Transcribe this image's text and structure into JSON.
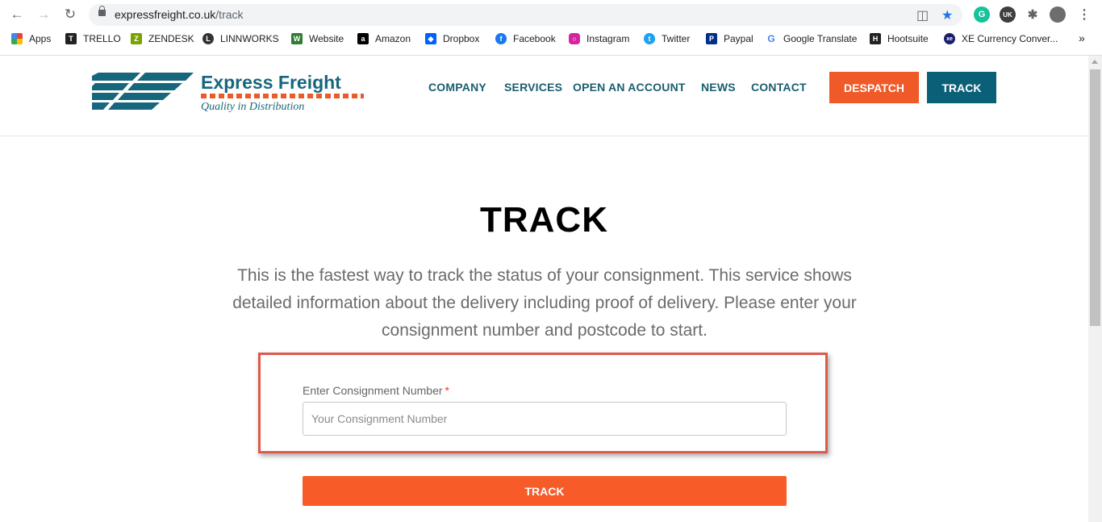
{
  "browser": {
    "url_host": "expressfreight.co.uk",
    "url_path": "/track",
    "bookmarks": [
      {
        "label": "Apps",
        "icon": "apps-grid-icon",
        "color": "#4285f4"
      },
      {
        "label": "TRELLO",
        "icon": "trello-icon",
        "color": "#222222"
      },
      {
        "label": "ZENDESK",
        "icon": "zendesk-icon",
        "color": "#78a300"
      },
      {
        "label": "LINNWORKS",
        "icon": "linnworks-icon",
        "color": "#333333"
      },
      {
        "label": "Website",
        "icon": "website-icon",
        "color": "#2e7d32"
      },
      {
        "label": "Amazon",
        "icon": "amazon-icon",
        "color": "#000000"
      },
      {
        "label": "Dropbox",
        "icon": "dropbox-icon",
        "color": "#0061ff"
      },
      {
        "label": "Facebook",
        "icon": "facebook-icon",
        "color": "#1877f2"
      },
      {
        "label": "Instagram",
        "icon": "instagram-icon",
        "color": "#d6249f"
      },
      {
        "label": "Twitter",
        "icon": "twitter-icon",
        "color": "#1da1f2"
      },
      {
        "label": "Paypal",
        "icon": "paypal-icon",
        "color": "#003087"
      },
      {
        "label": "Google Translate",
        "icon": "google-icon",
        "color": "#4285f4"
      },
      {
        "label": "Hootsuite",
        "icon": "hootsuite-icon",
        "color": "#222222"
      },
      {
        "label": "XE Currency Conver...",
        "icon": "xe-icon",
        "color": "#1b1f6b"
      }
    ],
    "overflow_glyph": "»",
    "extension_badge": "UK"
  },
  "header": {
    "logo_name": "Express Freight",
    "logo_tagline": "Quality in Distribution",
    "nav": [
      "COMPANY",
      "SERVICES",
      "OPEN AN ACCOUNT",
      "NEWS",
      "CONTACT"
    ],
    "despatch_label": "DESPATCH",
    "track_label": "TRACK"
  },
  "main": {
    "title": "TRACK",
    "intro": "This is the fastest way to track the status of your consignment. This service shows detailed information about the delivery including proof of delivery. Please enter your consignment number and postcode to start.",
    "field_label": "Enter Consignment Number",
    "required_mark": "*",
    "field_placeholder": "Your Consignment Number",
    "field_value": "",
    "submit_label": "TRACK"
  },
  "colors": {
    "brand_teal": "#0b6078",
    "brand_orange": "#f05a28",
    "highlight_border": "#dd5a4a"
  }
}
